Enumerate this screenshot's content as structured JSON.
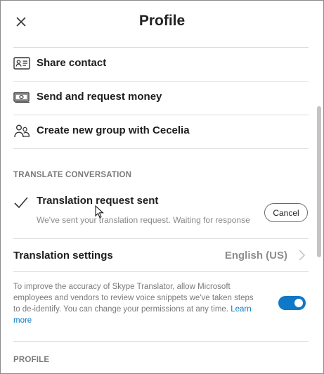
{
  "header": {
    "title": "Profile",
    "close_icon": "close-icon"
  },
  "menu": {
    "items": [
      {
        "label": "Share contact",
        "icon": "contact-card-icon"
      },
      {
        "label": "Send and request money",
        "icon": "money-icon"
      },
      {
        "label": "Create new group with Cecelia",
        "icon": "group-icon"
      }
    ]
  },
  "translate": {
    "section_label": "TRANSLATE CONVERSATION",
    "request_title": "Translation request sent",
    "request_subtitle": "We've sent your translation request. Waiting for response",
    "cancel_label": "Cancel",
    "settings_label": "Translation settings",
    "settings_value": "English (US)",
    "description": "To improve the accuracy of Skype Translator, allow Microsoft employees and vendors to review voice snippets we've taken steps to de-identify. You can change your permissions at any time.",
    "learn_more": "Learn more",
    "toggle_on": true
  },
  "profile_section": {
    "label": "PROFILE"
  },
  "colors": {
    "accent": "#0f78c8",
    "link": "#0a7bc4",
    "muted_text": "#7a7a7a"
  }
}
